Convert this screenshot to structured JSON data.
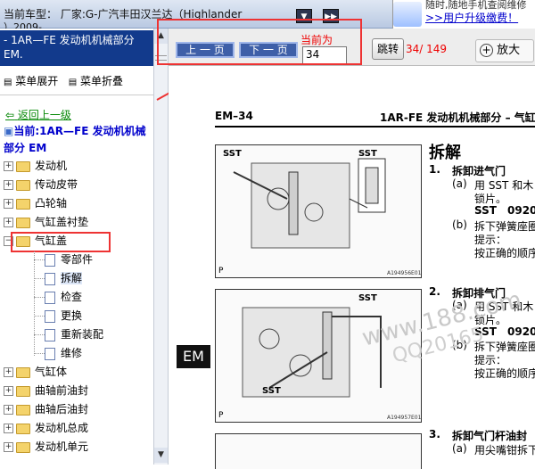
{
  "topbar": {
    "car_line1": "当前车型： 厂家:G-广汽丰田汉兰达（Highlander",
    "car_line2": "）2009-",
    "dropdown1_icon": "chevron-down-icon",
    "dropdown2_icon": "double-arrow-icon"
  },
  "ad": {
    "line1": "随时,随地手机查阅维修",
    "line2": ">>用户升级缴费！"
  },
  "left": {
    "doc_title": "- 1AR—FE 发动机机械部分 EM.",
    "expand_label": "菜单展开",
    "collapse_label": "菜单折叠",
    "back_label": "返回上一级",
    "current_label": "当前:1AR—FE 发动机机械部分 EM",
    "tree": {
      "items_top": [
        "发动机",
        "传动皮带",
        "凸轮轴",
        "气缸盖衬垫"
      ],
      "expanded": "气缸盖",
      "children": [
        "零部件",
        "拆解",
        "检查",
        "更换",
        "重新装配",
        "维修"
      ],
      "items_bottom": [
        "气缸体",
        "曲轴前油封",
        "曲轴后油封",
        "发动机总成",
        "发动机单元"
      ]
    }
  },
  "toolbar": {
    "prev_label": "上 一 页",
    "next_label": "下 一 页",
    "current_page_label": "当前为",
    "current_page_value": "34",
    "jump_label": "跳转",
    "page_count": "34/ 149",
    "zoom_label": "放大"
  },
  "doc": {
    "page_code": "EM–34",
    "header_right": "1AR-FE 发动机机械部分 – 气缸",
    "section_title": "拆解",
    "steps": [
      {
        "num": "1.",
        "title": "拆卸进气门",
        "line_a_label": "(a)",
        "line_a": "用 SST 和木",
        "line_a2": "锁片。",
        "sst_label": "SST",
        "sst_code": "0920",
        "line_b_label": "(b)",
        "line_b": "拆下弹簧座圈",
        "hint_label": "提示：",
        "hint_text": "按正确的顺序"
      },
      {
        "num": "2.",
        "title": "拆卸排气门",
        "line_a_label": "(a)",
        "line_a": "用 SST 和木",
        "line_a2": "锁片。",
        "sst_label": "SST",
        "sst_code": "0920",
        "line_b_label": "(b)",
        "line_b": "拆下弹簧座圈",
        "hint_label": "提示：",
        "hint_text": "按正确的顺序"
      },
      {
        "num": "3.",
        "title": "拆卸气门杆油封",
        "line_a_label": "(a)",
        "line_a": "用尖嘴钳拆下"
      }
    ],
    "fig1": {
      "sst1": "SST",
      "sst2": "SST",
      "id": "A194956E01",
      "p": "P"
    },
    "fig2": {
      "sst1": "SST",
      "sst2": "SST",
      "id": "A194957E01",
      "p": "P"
    },
    "em_tab": "EM",
    "watermark1": "www.188.com",
    "watermark2": "QQ20165"
  },
  "colors": {
    "accent": "#e33333",
    "title_bar": "#123a8c",
    "link": "#0000cc"
  }
}
